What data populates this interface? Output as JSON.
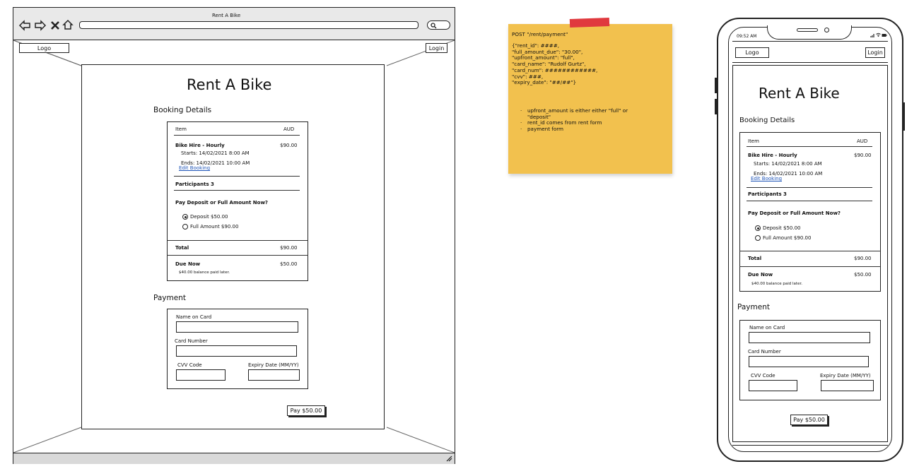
{
  "browser": {
    "title": "Rent A Bike",
    "nav_icons": [
      "back-arrow-icon",
      "forward-arrow-icon",
      "close-icon",
      "home-icon"
    ],
    "address_value": "",
    "search_icon": "search-icon"
  },
  "header": {
    "logo": "Logo",
    "login": "Login"
  },
  "page": {
    "title": "Rent A Bike",
    "booking_heading": "Booking Details",
    "payment_heading": "Payment",
    "pay_button": "Pay $50.00"
  },
  "booking": {
    "item_header": "Item",
    "currency_header": "AUD",
    "item_name": "Bike Hire - Hourly",
    "item_price": "$90.00",
    "starts": "Starts: 14/02/2021  8:00 AM",
    "ends": "Ends: 14/02/2021 10:00 AM",
    "edit_link": "Edit Booking",
    "participants_label": "Participants",
    "participants_value": "3",
    "pay_question": "Pay Deposit or Full Amount Now?",
    "options": [
      {
        "label": "Deposit $50.00",
        "selected": true
      },
      {
        "label": "Full Amount $90.00",
        "selected": false
      }
    ],
    "total_label": "Total",
    "total_value": "$90.00",
    "due_label": "Due Now",
    "due_value": "$50.00",
    "balance_note": "$40.00 balance paid later."
  },
  "payment": {
    "name_label": "Name on Card",
    "name_value": "",
    "card_label": "Card Number",
    "card_value": "",
    "cvv_label": "CVV Code",
    "cvv_value": "",
    "expiry_label": "Expiry Date (MM/YY)",
    "expiry_value": ""
  },
  "note": {
    "title": "POST \"/rent/payment\"",
    "body": [
      "{\"rent_id\": ####,",
      "\"full_amount_due\": \"30.00\",",
      "\"upfront_amount\": \"full\",",
      "\"card_name\": \"Rudolf Gurtz\",",
      "\"card_num\": ############,",
      "\"cvv\": ###,",
      "\"expiry_date\": \"##/##\"}"
    ],
    "bullets": [
      "upfront_amount is either either \"full\" or",
      "\"deposit\"",
      "rent_id comes from rent form",
      "payment form"
    ],
    "background": "#f2c14e",
    "tape_color": "#e0393e"
  },
  "mobile": {
    "time": "09:52 AM",
    "status_icons": [
      "signal-icon",
      "wifi-icon",
      "battery-icon"
    ]
  }
}
